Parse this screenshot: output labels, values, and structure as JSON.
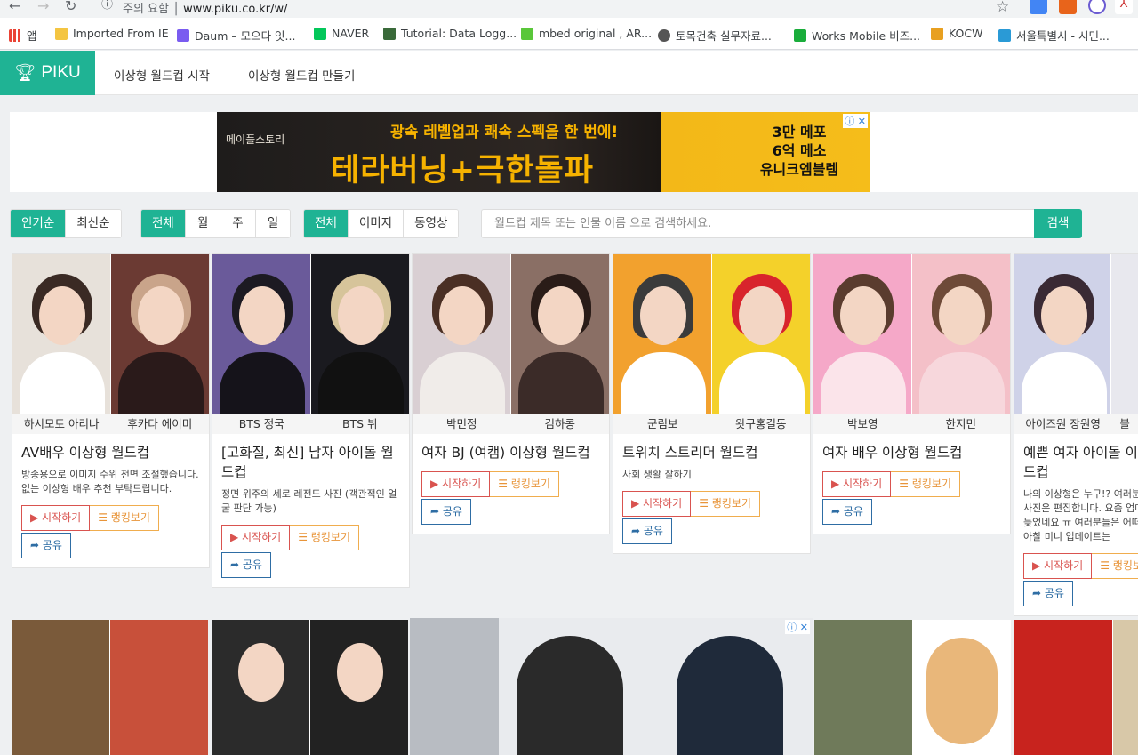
{
  "browser": {
    "security_label": "주의 요함",
    "url": "www.piku.co.kr/w/",
    "bookmarks": [
      {
        "label": "앱",
        "icon": "apps-grid-icon"
      },
      {
        "label": "Imported From IE",
        "icon": "folder-icon"
      },
      {
        "label": "Daum – 모으다 잇...",
        "icon": "daum-icon"
      },
      {
        "label": "NAVER",
        "icon": "naver-icon"
      },
      {
        "label": "Tutorial: Data Logg...",
        "icon": "image-icon"
      },
      {
        "label": "mbed original , AR...",
        "icon": "blog-icon"
      },
      {
        "label": "토목건축 실무자료...",
        "icon": "globe-icon"
      },
      {
        "label": "Works Mobile 비즈...",
        "icon": "works-icon"
      },
      {
        "label": "KOCW",
        "icon": "kocw-icon"
      },
      {
        "label": "서울특별시 - 시민...",
        "icon": "seoul-icon"
      }
    ]
  },
  "site": {
    "brand": "PIKU",
    "nav": [
      "이상형 월드컵 시작",
      "이상형 월드컵 만들기"
    ]
  },
  "ad": {
    "brand": "메이플스토리",
    "headline": "광속 레벨업과 쾌속 스펙을 한 번에!",
    "main": "테라버닝+극한돌파",
    "right_lines": [
      "3만 메포",
      "6억 메소",
      "유니크엠블렘"
    ]
  },
  "filters": {
    "sort": [
      "인기순",
      "최신순"
    ],
    "period": [
      "전체",
      "월",
      "주",
      "일"
    ],
    "media": [
      "전체",
      "이미지",
      "동영상"
    ],
    "search_placeholder": "월드컵 제목 또는 인물 이름 으로 검색하세요.",
    "search_button": "검색"
  },
  "buttons": {
    "start": "시작하기",
    "ranking": "랭킹보기",
    "share": "공유"
  },
  "cards": [
    {
      "left": "하시모토 아리나",
      "right": "후카다 에이미",
      "title": "AV배우 이상형 월드컵",
      "desc": "방송용으로 이미지 수위 전면 조절했습니다. 없는 이상형 배우 추천 부탁드립니다."
    },
    {
      "left": "BTS 정국",
      "right": "BTS 뷔",
      "title": "[고화질, 최신] 남자 아이돌 월드컵",
      "desc": "정면 위주의 세로 레전드 사진 (객관적인 얼굴 판단 가능)"
    },
    {
      "left": "박민정",
      "right": "김하콩",
      "title": "여자 BJ (여캠) 이상형 월드컵",
      "desc": ""
    },
    {
      "left": "군림보",
      "right": "왓구홍길동",
      "title": "트위치 스트리머 월드컵",
      "desc": "사회 생활 잘하기"
    },
    {
      "left": "박보영",
      "right": "한지민",
      "title": "여자 배우 이상형 월드컵",
      "desc": ""
    },
    {
      "left": "아이즈원 장원영",
      "right": "블",
      "title": "예쁜 여자 아이돌 이상형 월드컵",
      "desc": "나의 이상형은 누구!? 여러분 재밌게~사진은 편집합니다. 요즘 업데이트 좀 늦었네요 ㅠ 여러분들은 어떠신가요? 아찰 미니 업데이트는"
    }
  ],
  "colors": {
    "accent": "#1fb394",
    "start": "#d9534f",
    "ranking": "#f0ad4e",
    "share": "#2e6da4"
  }
}
